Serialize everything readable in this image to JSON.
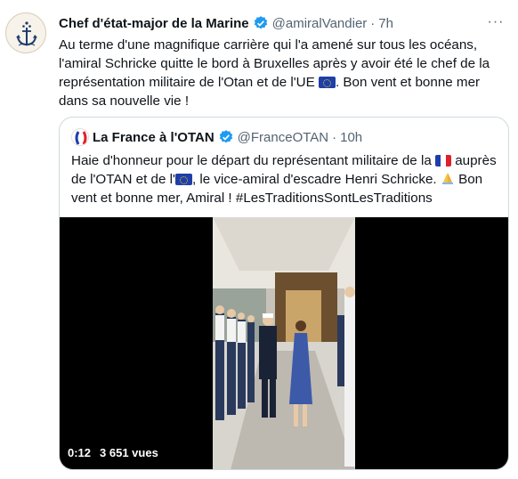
{
  "tweet": {
    "author_name": "Chef d'état-major de la Marine",
    "author_handle": "@amiralVandier",
    "separator": "·",
    "time": "7h",
    "more": "···",
    "text_before_flag": "Au terme d'une magnifique carrière qui l'a amené sur tous les océans, l'amiral Schricke quitte le bord à Bruxelles après y avoir été le chef de la représentation militaire de l'Otan et de l'UE ",
    "text_after_flag": ". Bon vent et bonne mer dans sa nouvelle vie !"
  },
  "quoted": {
    "author_name": "La France à l'OTAN",
    "author_handle": "@FranceOTAN",
    "separator": "·",
    "time": "10h",
    "text_part1": "Haie d'honneur pour le départ du représentant militaire de la ",
    "text_part2": " auprès de l'OTAN et de l'",
    "text_part3": ", le vice-amiral d'escadre Henri Schricke. ",
    "text_part4": " Bon vent et bonne mer, Amiral ! #LesTraditionsSontLesTraditions"
  },
  "video": {
    "duration": "0:12",
    "views": "3 651 vues"
  },
  "colors": {
    "text": "#0f1419",
    "muted": "#536471",
    "verified": "#1d9bf0",
    "border": "#cfd9de"
  },
  "icons": [
    "anchor-logo-icon",
    "verified-icon",
    "more-icon",
    "eu-flag-icon",
    "fr-flag-icon",
    "folded-hands-icon"
  ]
}
